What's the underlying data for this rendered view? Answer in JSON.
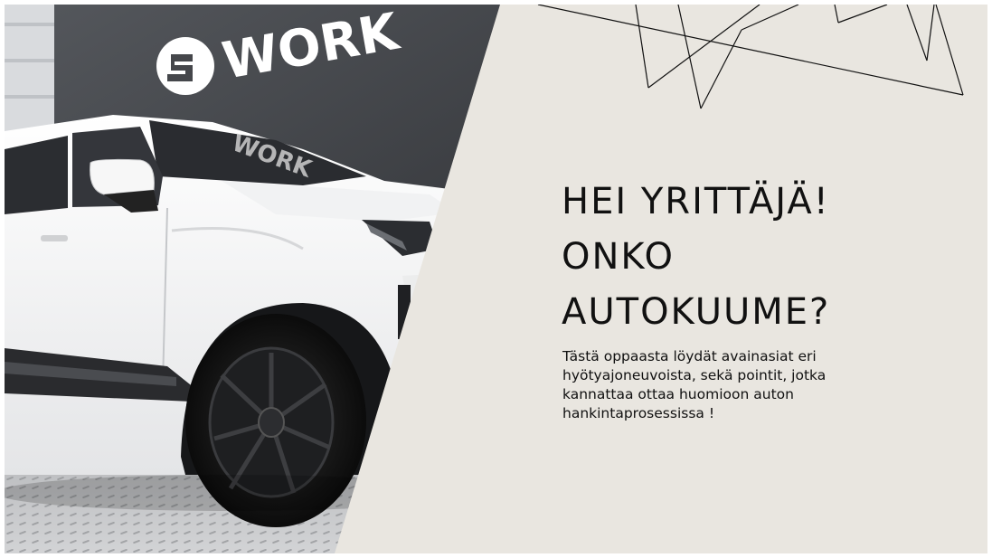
{
  "colors": {
    "panel": "#e9e6e0",
    "text": "#111111",
    "wall": "#45474b",
    "car": "#f3f3f3",
    "floor": "#b8b9bb"
  },
  "photo": {
    "description_icon": "car-photo",
    "sign_text": "WORK",
    "windshield_text": "WORK"
  },
  "heading": {
    "lines": [
      "HEI YRITTÄJÄ!",
      "ONKO",
      "AUTOKUUME?"
    ]
  },
  "body": {
    "lines": [
      "Tästä oppaasta löydät avainasiat eri",
      "hyötyajoneuvoista, sekä pointit, jotka",
      "kannattaa ottaa huomioon auton",
      "hankintaprosessissa !"
    ]
  }
}
